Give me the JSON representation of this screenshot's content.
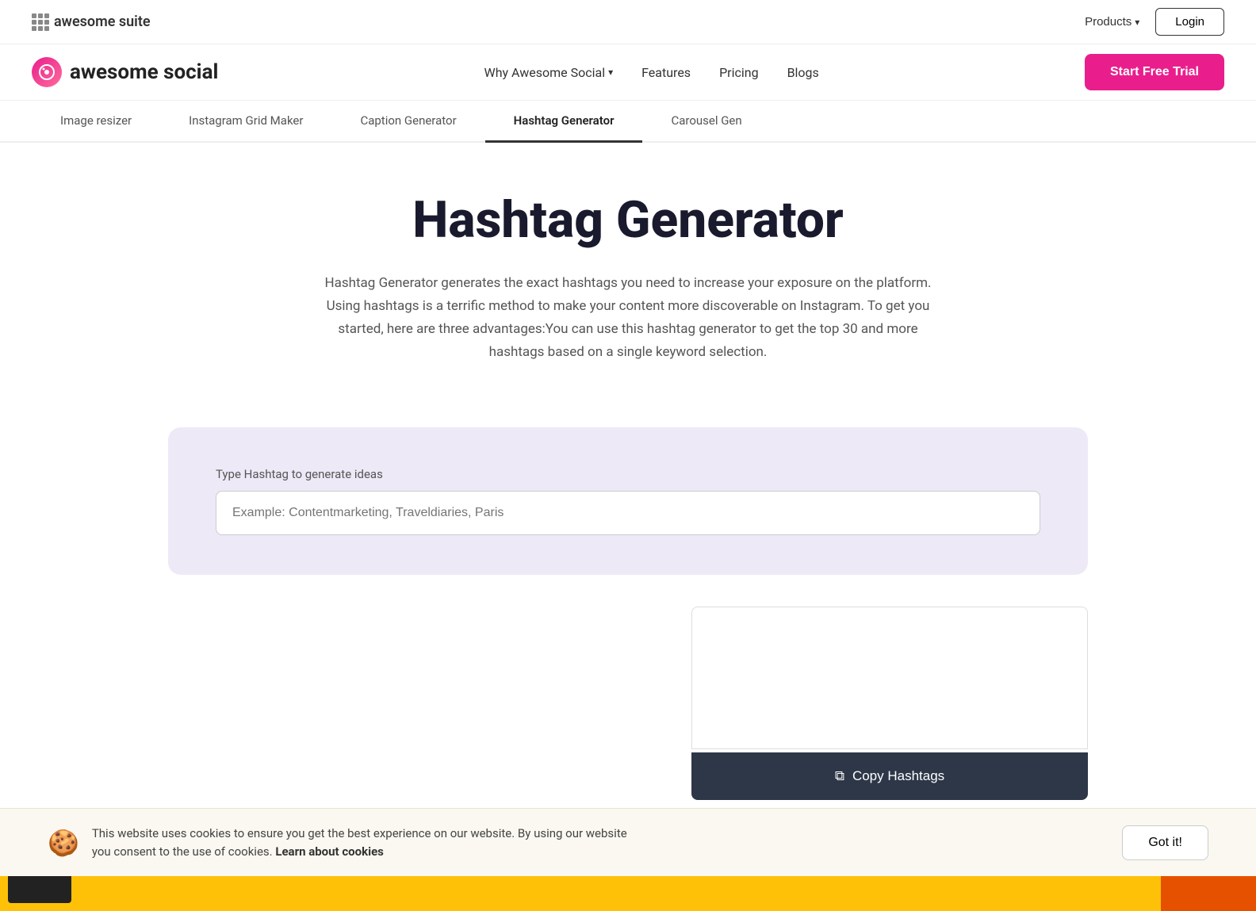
{
  "topbar": {
    "suite_label": "awesome suite",
    "products_label": "Products",
    "login_label": "Login"
  },
  "mainnav": {
    "brand_name": "awesome social",
    "nav": [
      {
        "id": "why",
        "label": "Why Awesome Social",
        "has_dropdown": true
      },
      {
        "id": "features",
        "label": "Features",
        "has_dropdown": false
      },
      {
        "id": "pricing",
        "label": "Pricing",
        "has_dropdown": false
      },
      {
        "id": "blogs",
        "label": "Blogs",
        "has_dropdown": false
      }
    ],
    "cta_label": "Start Free Trial"
  },
  "tabs": [
    {
      "id": "image-resizer",
      "label": "Image resizer",
      "active": false
    },
    {
      "id": "instagram-grid",
      "label": "Instagram Grid Maker",
      "active": false
    },
    {
      "id": "caption-gen",
      "label": "Caption Generator",
      "active": false
    },
    {
      "id": "hashtag-gen",
      "label": "Hashtag Generator",
      "active": true
    },
    {
      "id": "carousel-gen",
      "label": "Carousel Gen",
      "active": false
    }
  ],
  "hero": {
    "title": "Hashtag Generator",
    "description": "Hashtag Generator generates the exact hashtags you need to increase your exposure on the platform. Using hashtags is a terrific method to make your content more discoverable on Instagram. To get you started, here are three advantages:You can use this hashtag generator to get the top 30 and more hashtags based on a single keyword selection."
  },
  "generator": {
    "input_label": "Type Hashtag to generate ideas",
    "input_placeholder": "Example: Contentmarketing, Traveldiaries, Paris"
  },
  "output": {
    "copy_btn_label": "Copy Hashtags",
    "copy_icon": "⧉"
  },
  "cookie": {
    "icon": "🍪",
    "message": "This website uses cookies to ensure you get the best experience on our website. By using our website you consent to the use of cookies.",
    "learn_more": "Learn about cookies",
    "accept_label": "Got it!"
  }
}
